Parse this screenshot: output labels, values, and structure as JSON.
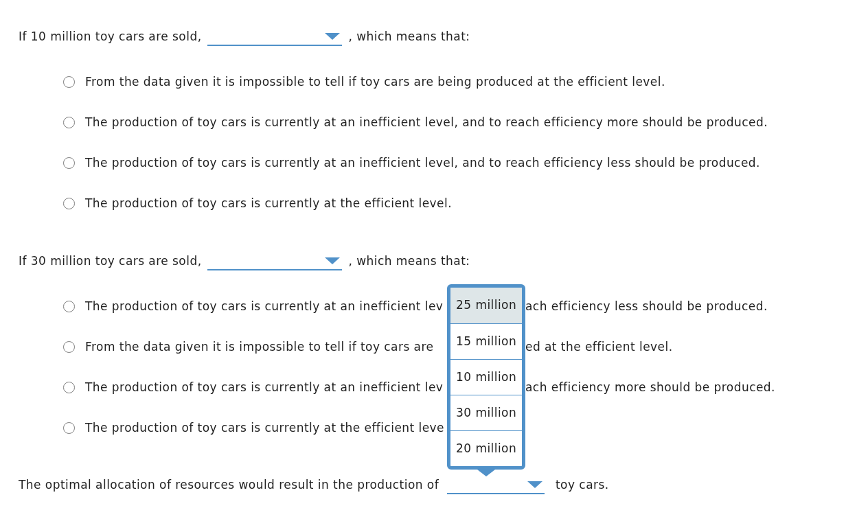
{
  "questions": [
    {
      "lead": "If 10 million toy cars are sold,",
      "trail": ", which means that:",
      "options": [
        {
          "text": "From the data given it is impossible to tell if toy cars are being produced at the efficient level.",
          "selected": false
        },
        {
          "text": "The production of toy cars is currently at an inefficient level, and to reach efficiency more should be produced.",
          "selected": false
        },
        {
          "text": "The production of toy cars is currently at an inefficient level, and to reach efficiency less should be produced.",
          "selected": false
        },
        {
          "text": "The production of toy cars is currently at the efficient level.",
          "selected": false
        }
      ]
    },
    {
      "lead": "If 30 million toy cars are sold,",
      "trail": ", which means that:",
      "options": [
        {
          "text_start": "The production of toy cars is currently at an inefficient lev",
          "text_end": "ach efficiency less should be produced.",
          "selected": false
        },
        {
          "text_start": "From the data given it is impossible to tell if toy cars are",
          "text_end": "ed at the efficient level.",
          "selected": false
        },
        {
          "text_start": "The production of toy cars is currently at an inefficient lev",
          "text_end": "ach efficiency more should be produced.",
          "selected": false
        },
        {
          "text_start": "The production of toy cars is currently at the efficient leve",
          "selected": false
        }
      ]
    }
  ],
  "conclusion": {
    "lead": "The optimal allocation of resources would result in the production of",
    "dropdown": {
      "expanded": true,
      "options": [
        {
          "label": "25 million",
          "highlighted": true
        },
        {
          "label": "15 million",
          "highlighted": false
        },
        {
          "label": "10 million",
          "highlighted": false
        },
        {
          "label": "30 million",
          "highlighted": false
        },
        {
          "label": "20 million",
          "highlighted": false
        }
      ]
    },
    "trail": "toy cars."
  }
}
